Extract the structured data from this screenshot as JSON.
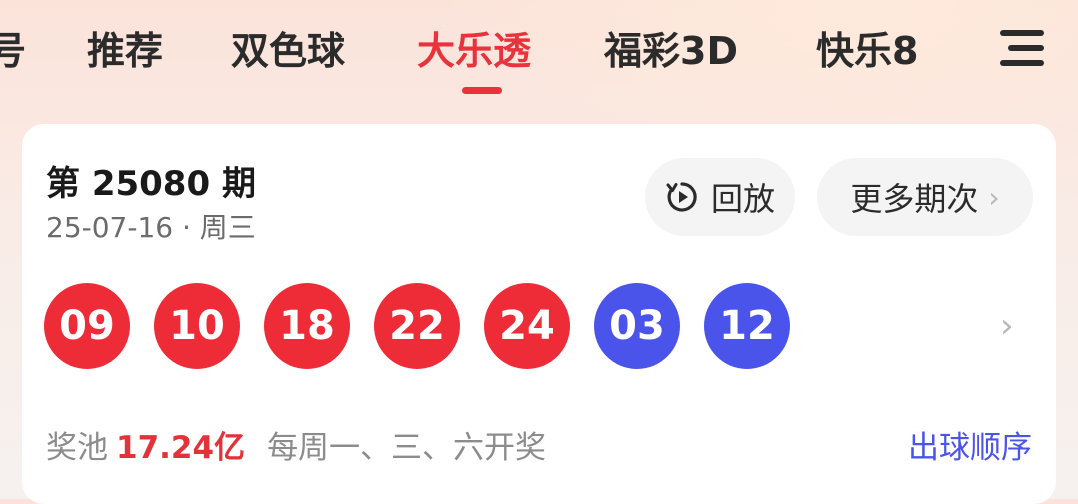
{
  "tabs": {
    "items": [
      {
        "label": "号"
      },
      {
        "label": "推荐"
      },
      {
        "label": "双色球"
      },
      {
        "label": "大乐透"
      },
      {
        "label": "福彩3D"
      },
      {
        "label": "快乐8"
      }
    ],
    "active": "大乐透",
    "menu_icon": "hamburger-menu-icon"
  },
  "draw": {
    "issue": "第 25080 期",
    "date": "25-07-16 · 周三",
    "replay_label": "回放",
    "replay_icon": "replay-icon",
    "more_label": "更多期次",
    "red_balls": [
      "09",
      "10",
      "18",
      "22",
      "24"
    ],
    "blue_balls": [
      "03",
      "12"
    ],
    "pool_label": "奖池",
    "pool_amount": "17.24亿",
    "schedule": "每周一、三、六开奖",
    "order_link": "出球顺序"
  },
  "colors": {
    "accent_red": "#e8323c",
    "ball_red": "#ee2c37",
    "ball_blue": "#4a54ea",
    "link_blue": "#4a54ea"
  }
}
